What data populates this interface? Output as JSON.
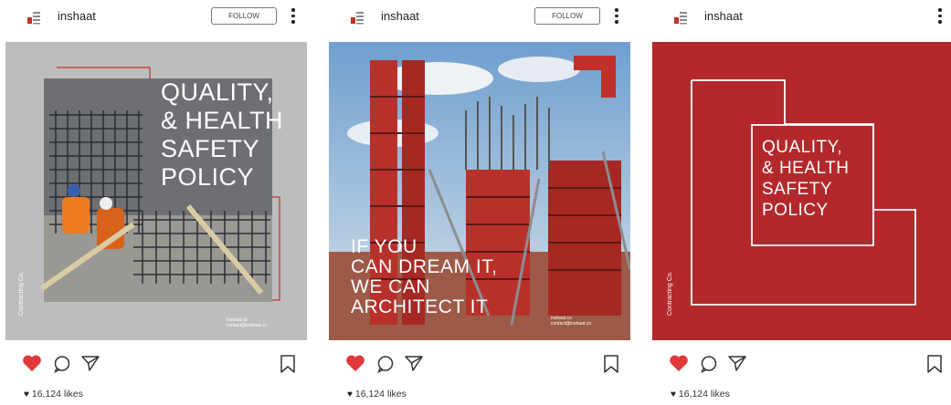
{
  "posts": [
    {
      "username": "inshaat",
      "follow_label": "FOLLOW",
      "headline": [
        "QUALITY,",
        "& HEALTH",
        "SAFETY",
        "POLICY"
      ],
      "side_text": "Contracting Co.",
      "contact": [
        "inshaat.co",
        "contact@inshaat.co"
      ],
      "likes": "16,124 likes"
    },
    {
      "username": "inshaat",
      "follow_label": "FOLLOW",
      "headline": [
        "IF YOU",
        "CAN DREAM IT,",
        "WE CAN",
        "ARCHITECT IT"
      ],
      "contact": [
        "inshaat.co",
        "contact@inshaat.co"
      ],
      "likes": "16,124 likes"
    },
    {
      "username": "inshaat",
      "headline": [
        "QUALITY,",
        "& HEALTH",
        "SAFETY",
        "POLICY"
      ],
      "side_text": "Contracting Co.",
      "likes": "16,124 likes"
    }
  ],
  "colors": {
    "brand_red": "#c0312b",
    "heart_red": "#e0393b",
    "gray_bg": "#bdbdbd"
  },
  "icons": [
    "brand-logo-icon",
    "kebab-menu-icon",
    "heart-icon",
    "comment-icon",
    "send-icon",
    "bookmark-icon"
  ]
}
